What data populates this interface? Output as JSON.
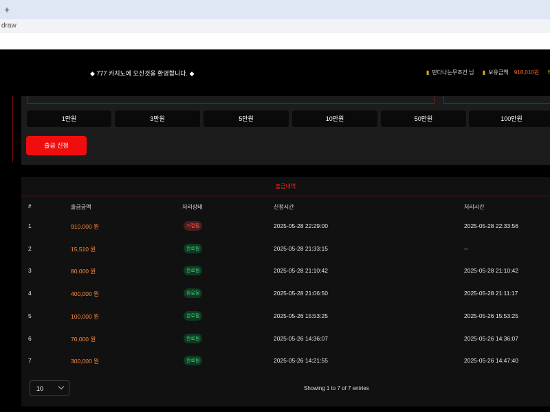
{
  "browser": {
    "newtab": "+",
    "url": "draw"
  },
  "header": {
    "welcome": "◆ 777 카지노에 오신것을 환영합니다. ◆",
    "username": "딴다나는무조건 님",
    "balance_label": "보유금액",
    "balance": "918,010원",
    "refresh": "↻"
  },
  "amount_buttons": [
    "1만원",
    "3만원",
    "5만원",
    "10만원",
    "50만원",
    "100만원"
  ],
  "submit_label": "출금 신청",
  "history": {
    "title": "출금내역",
    "columns": [
      "#",
      "출금금액",
      "처리상태",
      "신청시간",
      "처리시간"
    ],
    "rows": [
      {
        "no": "1",
        "amount": "910,000 원",
        "status": "거절됨",
        "status_type": "rejected",
        "requested": "2025-05-28 22:29:00",
        "processed": "2025-05-28 22:33:56"
      },
      {
        "no": "2",
        "amount": "15,510 원",
        "status": "완료됨",
        "status_type": "done",
        "requested": "2025-05-28 21:33:15",
        "processed": "--"
      },
      {
        "no": "3",
        "amount": "80,000 원",
        "status": "완료됨",
        "status_type": "done",
        "requested": "2025-05-28 21:10:42",
        "processed": "2025-05-28 21:10:42"
      },
      {
        "no": "4",
        "amount": "400,000 원",
        "status": "완료됨",
        "status_type": "done",
        "requested": "2025-05-28 21:06:50",
        "processed": "2025-05-28 21:11:17"
      },
      {
        "no": "5",
        "amount": "100,000 원",
        "status": "완료됨",
        "status_type": "done",
        "requested": "2025-05-26 15:53:25",
        "processed": "2025-05-26 15:53:25"
      },
      {
        "no": "6",
        "amount": "70,000 원",
        "status": "완료됨",
        "status_type": "done",
        "requested": "2025-05-26 14:36:07",
        "processed": "2025-05-26 14:36:07"
      },
      {
        "no": "7",
        "amount": "300,000 원",
        "status": "완료됨",
        "status_type": "done",
        "requested": "2025-05-26 14:21:55",
        "processed": "2025-05-26 14:47:40"
      }
    ],
    "per_page": "10",
    "info": "Showing 1 to 7 of 7 entries"
  },
  "colors": {
    "accent_red": "#f00d0d",
    "amount_orange": "#ff8a3c",
    "done_green": "#3fd27a",
    "rejected_red": "#ff5a5a",
    "gold": "#e5b100"
  }
}
